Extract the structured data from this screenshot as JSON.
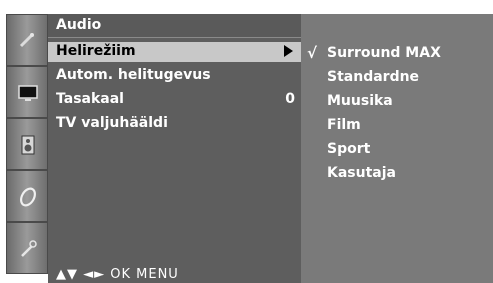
{
  "main_menu": {
    "title": "Audio",
    "items": [
      {
        "label": "Helirežiim",
        "value": "",
        "selected": true,
        "has_submenu": true
      },
      {
        "label": "Autom. helitugevus",
        "value": "",
        "selected": false,
        "has_submenu": false
      },
      {
        "label": "Tasakaal",
        "value": "0",
        "selected": false,
        "has_submenu": false
      },
      {
        "label": "TV valjuhääldi",
        "value": "",
        "selected": false,
        "has_submenu": false
      }
    ],
    "footer": "▲▼  ◄►  OK  MENU"
  },
  "submenu": {
    "items": [
      {
        "label": "Surround MAX",
        "check": "√",
        "checked": true
      },
      {
        "label": "Standardne",
        "check": "",
        "checked": false
      },
      {
        "label": "Muusika",
        "check": "",
        "checked": false
      },
      {
        "label": "Film",
        "check": "",
        "checked": false
      },
      {
        "label": "Sport",
        "check": "",
        "checked": false
      },
      {
        "label": "Kasutaja",
        "check": "",
        "checked": false
      }
    ]
  },
  "rail": {
    "icons": [
      "satellite-dish-icon",
      "screen-picture-icon",
      "speaker-audio-icon",
      "clock-time-icon",
      "wrench-setup-icon"
    ]
  },
  "colors": {
    "main_bg": "#5e5e5e",
    "submenu_bg": "#7a7a7a",
    "selected_row": "#c8c8c8",
    "text": "#ffffff"
  }
}
